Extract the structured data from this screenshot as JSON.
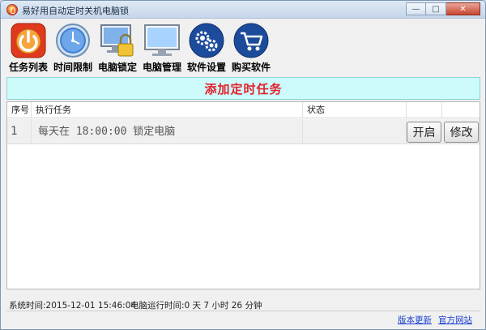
{
  "window": {
    "title": "易好用自动定时关机电脑锁",
    "minimize": "—",
    "maximize": "□",
    "close": "✕"
  },
  "toolbar": {
    "items": [
      {
        "label": "任务列表",
        "icon": "power-icon"
      },
      {
        "label": "时间限制",
        "icon": "clock-icon"
      },
      {
        "label": "电脑锁定",
        "icon": "monitor-lock-icon"
      },
      {
        "label": "电脑管理",
        "icon": "monitor-icon"
      },
      {
        "label": "软件设置",
        "icon": "gears-icon"
      },
      {
        "label": "购买软件",
        "icon": "cart-icon"
      }
    ]
  },
  "banner": {
    "text": "添加定时任务"
  },
  "table": {
    "headers": [
      "序号",
      "执行任务",
      "状态"
    ],
    "rows": [
      {
        "index": "1",
        "task": "每天在 18:00:00 锁定电脑",
        "status": "",
        "enable_label": "开启",
        "edit_label": "修改"
      }
    ]
  },
  "status": {
    "system_time": "系统时间:2015-12-01 15:46:04",
    "uptime": "电脑运行时间:0 天 7 小时 26 分钟"
  },
  "links": {
    "update": "版本更新",
    "website": "官方网站"
  },
  "colors": {
    "banner_text": "#e3212b",
    "banner_bg": "#cdfafb",
    "link": "#1a3fd0"
  }
}
